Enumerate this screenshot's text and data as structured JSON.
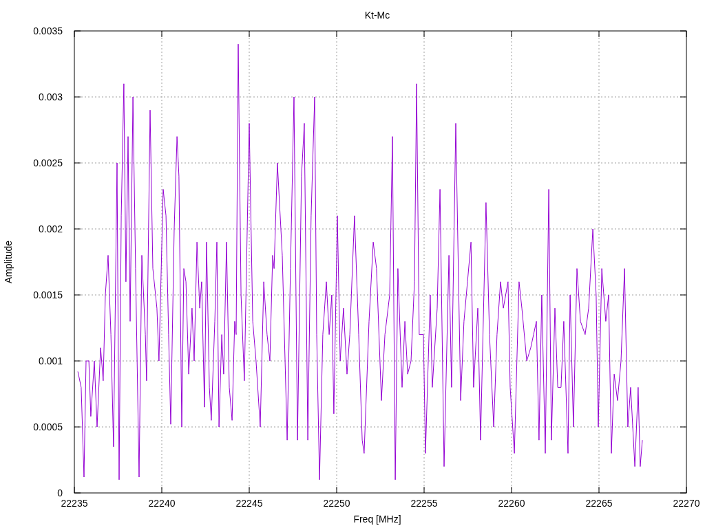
{
  "chart_data": {
    "type": "line",
    "grid": true,
    "title": "Kt-Mc",
    "xlabel": "Freq [MHz]",
    "ylabel": "Amplitude",
    "xlim": [
      22235,
      22270
    ],
    "ylim": [
      0,
      0.0035
    ],
    "xticks": [
      22235,
      22240,
      22245,
      22250,
      22255,
      22260,
      22265,
      22270
    ],
    "yticks": [
      0,
      0.0005,
      0.001,
      0.0015,
      0.002,
      0.0025,
      0.003,
      0.0035
    ],
    "x": [
      22235.2,
      22235.39,
      22235.55,
      22235.67,
      22235.83,
      22235.94,
      22236.14,
      22236.3,
      22236.5,
      22236.65,
      22236.77,
      22236.93,
      22237.09,
      22237.24,
      22237.44,
      22237.56,
      22237.68,
      22237.83,
      22237.95,
      22238.07,
      22238.19,
      22238.35,
      22238.5,
      22238.7,
      22238.86,
      22239.06,
      22239.13,
      22239.33,
      22239.49,
      22239.72,
      22239.84,
      22240.08,
      22240.24,
      22240.39,
      22240.51,
      22240.71,
      22240.87,
      22240.98,
      22241.14,
      22241.26,
      22241.38,
      22241.54,
      22241.73,
      22241.85,
      22242.01,
      22242.17,
      22242.28,
      22242.44,
      22242.56,
      22242.72,
      22242.83,
      22243.03,
      22243.15,
      22243.27,
      22243.43,
      22243.54,
      22243.7,
      22243.86,
      22244.02,
      22244.17,
      22244.25,
      22244.37,
      22244.53,
      22244.72,
      22245.0,
      22245.2,
      22245.39,
      22245.63,
      22245.83,
      22246.02,
      22246.18,
      22246.34,
      22246.42,
      22246.61,
      22246.89,
      22247.17,
      22247.36,
      22247.56,
      22247.76,
      22247.99,
      22248.15,
      22248.35,
      22248.54,
      22248.74,
      22248.86,
      22249.02,
      22249.21,
      22249.41,
      22249.57,
      22249.72,
      22249.84,
      22250.04,
      22250.2,
      22250.39,
      22250.59,
      22250.75,
      22251.02,
      22251.26,
      22251.46,
      22251.57,
      22251.85,
      22252.09,
      22252.28,
      22252.56,
      22252.76,
      22253.03,
      22253.19,
      22253.35,
      22253.5,
      22253.74,
      22253.9,
      22254.06,
      22254.25,
      22254.45,
      22254.57,
      22254.72,
      22254.96,
      22255.08,
      22255.35,
      22255.47,
      22255.75,
      22255.91,
      22256.14,
      22256.42,
      22256.57,
      22256.81,
      22257.09,
      22257.28,
      22257.48,
      22257.68,
      22257.83,
      22258.07,
      22258.23,
      22258.54,
      22258.74,
      22258.98,
      22259.17,
      22259.37,
      22259.53,
      22259.8,
      22259.92,
      22260.16,
      22260.43,
      22260.59,
      22260.87,
      22261.1,
      22261.26,
      22261.42,
      22261.57,
      22261.73,
      22261.93,
      22262.13,
      22262.28,
      22262.48,
      22262.64,
      22262.83,
      22262.99,
      22263.23,
      22263.35,
      22263.54,
      22263.74,
      22263.94,
      22264.21,
      22264.41,
      22264.65,
      22264.84,
      22264.96,
      22265.16,
      22265.39,
      22265.55,
      22265.71,
      22265.87,
      22266.06,
      22266.26,
      22266.46,
      22266.65,
      22266.81,
      22267.05,
      22267.24,
      22267.36,
      22267.48
    ],
    "series": [
      {
        "color": "#9400d3",
        "values": [
          0.00092,
          0.0008,
          0.00012,
          0.001,
          0.001,
          0.00058,
          0.001,
          0.0005,
          0.0011,
          0.00085,
          0.0015,
          0.0018,
          0.0012,
          0.00035,
          0.0025,
          0.0001,
          0.0021,
          0.0031,
          0.0016,
          0.0027,
          0.0013,
          0.003,
          0.0017,
          0.00012,
          0.0018,
          0.0012,
          0.00085,
          0.0029,
          0.0017,
          0.0014,
          0.001,
          0.0023,
          0.0021,
          0.0012,
          0.00052,
          0.002,
          0.0027,
          0.0024,
          0.0005,
          0.0017,
          0.0016,
          0.0009,
          0.0014,
          0.001,
          0.0019,
          0.0014,
          0.0016,
          0.00065,
          0.0019,
          0.0008,
          0.00055,
          0.0013,
          0.0019,
          0.0005,
          0.0012,
          0.0009,
          0.0019,
          0.0008,
          0.00055,
          0.0013,
          0.0012,
          0.0034,
          0.0015,
          0.00085,
          0.0028,
          0.0013,
          0.001,
          0.0005,
          0.0016,
          0.0012,
          0.001,
          0.0018,
          0.0017,
          0.0025,
          0.0018,
          0.0004,
          0.0017,
          0.003,
          0.0004,
          0.0024,
          0.0028,
          0.0004,
          0.0021,
          0.003,
          0.0012,
          0.0001,
          0.0012,
          0.0016,
          0.0012,
          0.0015,
          0.0006,
          0.0021,
          0.001,
          0.0014,
          0.0009,
          0.0012,
          0.0021,
          0.0012,
          0.0004,
          0.0003,
          0.0013,
          0.0019,
          0.0017,
          0.0007,
          0.0012,
          0.0015,
          0.0027,
          0.0001,
          0.0017,
          0.0008,
          0.0013,
          0.0009,
          0.001,
          0.0016,
          0.0031,
          0.0012,
          0.0012,
          0.0003,
          0.0015,
          0.0008,
          0.0014,
          0.0023,
          0.0002,
          0.0018,
          0.0008,
          0.0028,
          0.0007,
          0.0013,
          0.0016,
          0.0019,
          0.0008,
          0.0014,
          0.0004,
          0.0022,
          0.0012,
          0.0005,
          0.0012,
          0.0016,
          0.0014,
          0.0016,
          0.0008,
          0.0003,
          0.0016,
          0.0014,
          0.001,
          0.0011,
          0.0012,
          0.0013,
          0.0004,
          0.0015,
          0.0003,
          0.0023,
          0.0004,
          0.0014,
          0.0008,
          0.0008,
          0.0013,
          0.0003,
          0.0015,
          0.0005,
          0.0017,
          0.0013,
          0.0012,
          0.0014,
          0.002,
          0.0015,
          0.0005,
          0.0017,
          0.0013,
          0.0015,
          0.0003,
          0.0009,
          0.0007,
          0.001,
          0.0017,
          0.0005,
          0.0008,
          0.0002,
          0.0008,
          0.0002,
          0.0004
        ]
      }
    ]
  }
}
